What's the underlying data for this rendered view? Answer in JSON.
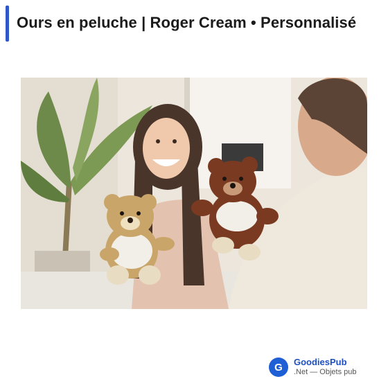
{
  "page": {
    "title": "Ours en peluche | Roger Cream • Personnalisé"
  },
  "photo": {
    "icon": "product-photo"
  },
  "brand": {
    "badge_letter": "G",
    "name": "GoodiesPub",
    "tagline": ".Net — Objets pub",
    "color": "#1f5fd6"
  },
  "colors": {
    "accent_bar": "#2f57c9"
  }
}
